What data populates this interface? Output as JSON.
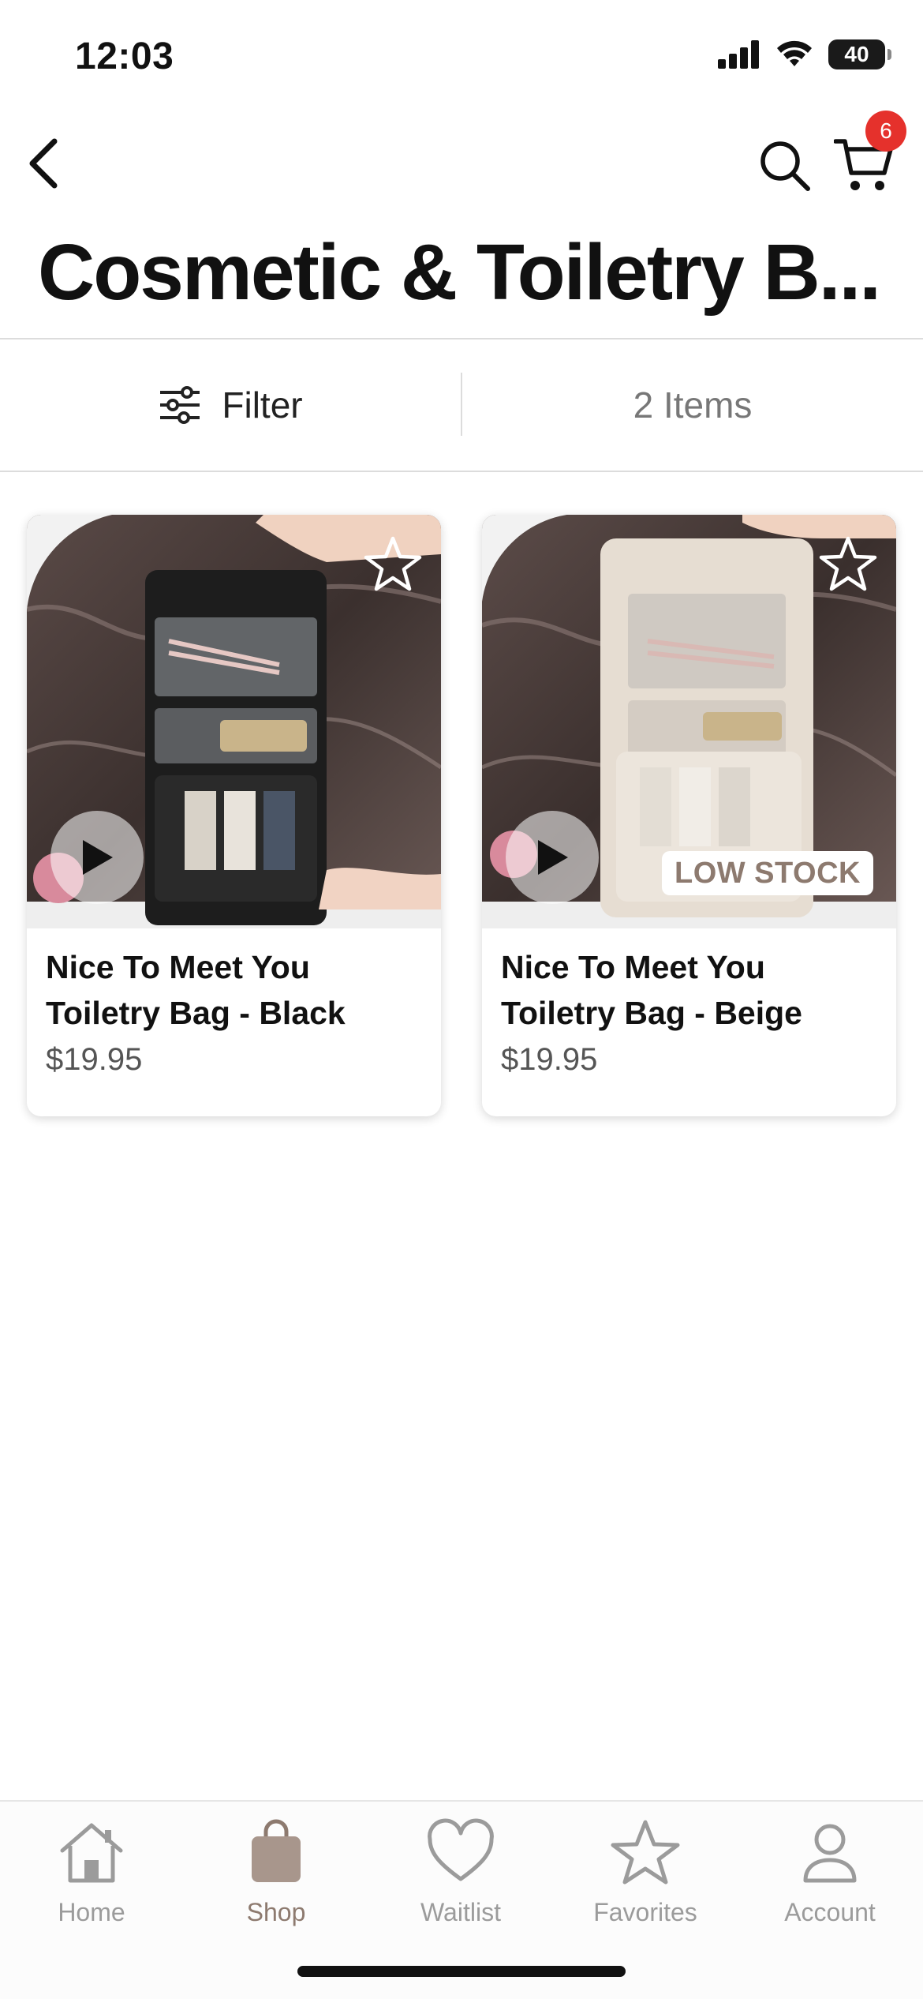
{
  "status_bar": {
    "time": "12:03",
    "battery": "40",
    "icons": [
      "signal-icon",
      "wifi-icon",
      "battery-icon"
    ]
  },
  "nav": {
    "back_icon": "chevron-left-icon",
    "search_icon": "search-icon",
    "cart_icon": "cart-icon",
    "cart_count": "6"
  },
  "page_title": "Cosmetic & Toiletry B...",
  "filter": {
    "label": "Filter",
    "icon": "sliders-icon",
    "item_count": "2 Items"
  },
  "products": [
    {
      "name": "Nice To Meet You Toiletry Bag - Black",
      "price": "$19.95",
      "badge": ""
    },
    {
      "name": "Nice To Meet You Toiletry Bag - Beige",
      "price": "$19.95",
      "badge": "LOW STOCK"
    }
  ],
  "tab_bar": {
    "active": "Shop",
    "tabs": [
      {
        "label": "Home",
        "icon": "home-icon"
      },
      {
        "label": "Shop",
        "icon": "shopping-bag-icon"
      },
      {
        "label": "Waitlist",
        "icon": "heart-icon"
      },
      {
        "label": "Favorites",
        "icon": "star-icon"
      },
      {
        "label": "Account",
        "icon": "person-icon"
      }
    ]
  },
  "colors": {
    "accent": "#8d7a6f",
    "badge": "#e5312c",
    "inactive_tab": "#9b9b9b"
  }
}
